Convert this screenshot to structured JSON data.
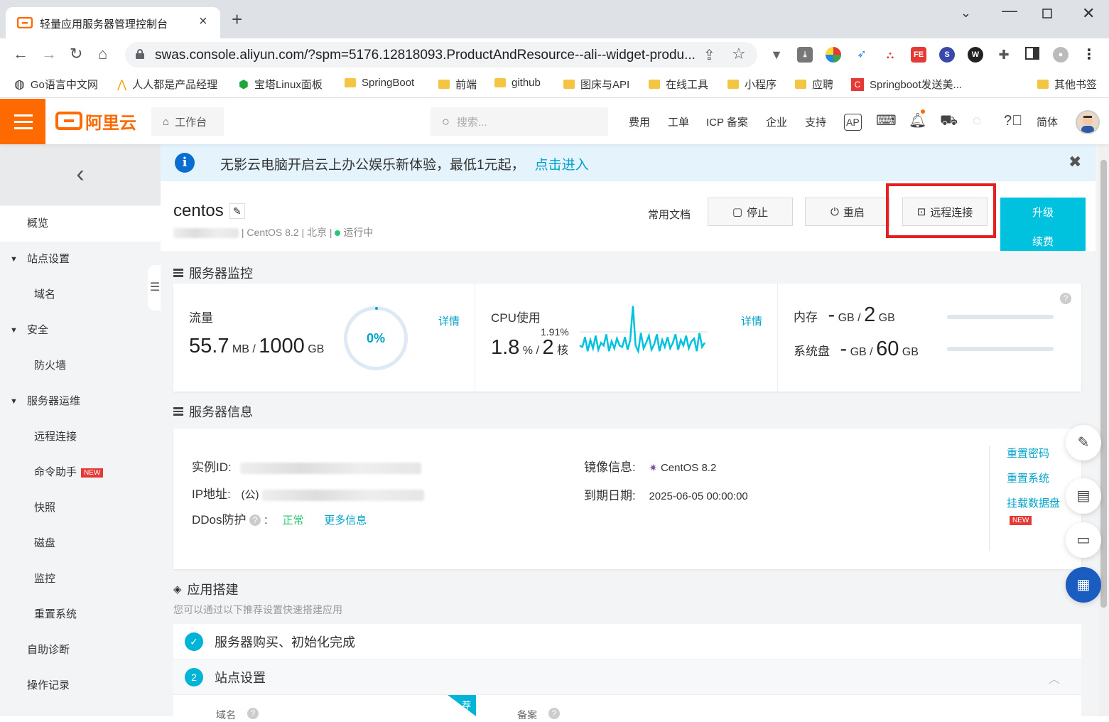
{
  "browser": {
    "tab_title": "轻量应用服务器管理控制台",
    "url": "swas.console.aliyun.com/?spm=5176.12818093.ProductAndResource--ali--widget-produ...",
    "bookmarks": [
      "Go语言中文网",
      "人人都是产品经理",
      "宝塔Linux面板",
      "SpringBoot",
      "前端",
      "github",
      "图床与API",
      "在线工具",
      "小程序",
      "应聘",
      "Springboot发送美...",
      "其他书签"
    ]
  },
  "header": {
    "logo_text": "阿里云",
    "workbench": "工作台",
    "search_placeholder": "搜索...",
    "menu": [
      "费用",
      "工单",
      "ICP 备案",
      "企业",
      "支持"
    ],
    "lang": "简体"
  },
  "sidebar": {
    "items": [
      "概览",
      "站点设置",
      "域名",
      "安全",
      "防火墙",
      "服务器运维",
      "远程连接",
      "命令助手",
      "快照",
      "磁盘",
      "监控",
      "重置系统",
      "自助诊断",
      "操作记录"
    ],
    "new_badge": "NEW"
  },
  "banner": {
    "text": "无影云电脑开启云上办公娱乐新体验，最低1元起，",
    "link": "点击进入"
  },
  "instance": {
    "name": "centos",
    "os": "CentOS 8.2",
    "region": "北京",
    "status": "运行中",
    "docs": "常用文档",
    "stop": "停止",
    "restart": "重启",
    "remote": "远程连接",
    "upgrade": "升级",
    "renew": "续费"
  },
  "monitor": {
    "title": "服务器监控",
    "traffic_label": "流量",
    "traffic_used": "55.7",
    "traffic_used_unit": "MB",
    "traffic_total": "1000",
    "traffic_total_unit": "GB",
    "traffic_percent": "0%",
    "detail": "详情",
    "cpu_label": "CPU使用",
    "cpu_peak": "1.91%",
    "cpu_value": "1.8",
    "cpu_unit": "%",
    "cpu_cores": "2",
    "cpu_cores_unit": "核",
    "mem_label": "内存",
    "mem_used": "-",
    "mem_total": "2",
    "disk_label": "系统盘",
    "disk_used": "-",
    "disk_total": "60",
    "gb": "GB",
    "cpu_series": [
      0.5,
      0.45,
      0.8,
      0.3,
      0.7,
      0.4,
      0.85,
      0.35,
      0.6,
      0.5,
      0.9,
      0.3,
      0.65,
      0.4,
      0.75,
      0.5,
      0.45,
      0.8,
      0.35,
      0.7,
      1.91,
      0.5,
      0.3,
      0.95,
      0.4,
      0.6,
      0.85,
      0.35,
      0.55,
      0.9,
      0.3,
      0.7,
      0.45,
      0.8,
      0.4,
      0.6,
      0.9,
      0.35,
      0.7,
      0.5,
      0.85,
      0.4,
      0.65,
      0.75,
      0.3,
      0.95,
      0.45,
      0.6
    ]
  },
  "server_info": {
    "title": "服务器信息",
    "instance_id_label": "实例ID:",
    "ip_label": "IP地址:",
    "ip_prefix": "(公)",
    "ddos_label": "DDos防护",
    "ddos_status": "正常",
    "more_info": "更多信息",
    "image_label": "镜像信息:",
    "image_value": "CentOS 8.2",
    "expire_label": "到期日期:",
    "expire_value": "2025-06-05 00:00:00",
    "actions": [
      "重置密码",
      "重置系统",
      "挂载数据盘"
    ],
    "new_badge": "NEW"
  },
  "app_build": {
    "title": "应用搭建",
    "subtitle": "您可以通过以下推荐设置快速搭建应用",
    "step1": "服务器购买、初始化完成",
    "step2_num": "2",
    "step2": "站点设置",
    "col_domain": "域名",
    "col_icp": "备案",
    "rec_badge": "荐"
  },
  "colors": {
    "brand": "#ff6a00",
    "accent": "#00c1de",
    "link": "#00a2ca",
    "highlight": "#e62020"
  }
}
